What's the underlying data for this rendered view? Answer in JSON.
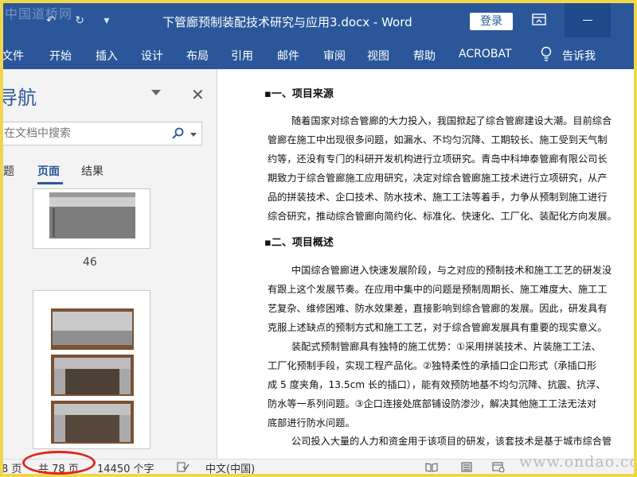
{
  "watermarks": {
    "top": "中国道桥网",
    "bottom": "www.ondao.com"
  },
  "titlebar": {
    "qat_undo": "↶",
    "qat_redo": "↻",
    "qat_more": "▾",
    "title": "下管廊预制装配技术研究与应用3.docx  -  Word",
    "login": "登录"
  },
  "ribbon": {
    "tabs": [
      "文件",
      "开始",
      "插入",
      "设计",
      "布局",
      "引用",
      "邮件",
      "审阅",
      "视图",
      "帮助",
      "ACROBAT",
      "告诉我"
    ]
  },
  "nav": {
    "title": "导航",
    "close": "✕",
    "search_placeholder": "在文档中搜索",
    "tabs": [
      "题",
      "页面",
      "结果"
    ],
    "page_number": "46"
  },
  "document": {
    "h1": "一、项目来源",
    "p1": [
      "随着国家对综合管廊的大力投入，我国掀起了综合管廊建设大潮。目前综合",
      "管廊在施工中出现很多问题，如漏水、不均匀沉降、工期较长、施工受到天气制",
      "约等，还没有专门的科研开发机构进行立项研究。青岛中科坤泰管廊有限公司长",
      "期致力于综合管廊施工应用研究，决定对综合管廊施工技术进行立项研究，从产",
      "品的拼装技术、企口技术、防水技术、施工工法等着手，力争从预制到施工进行",
      "综合研究，推动综合管廊向简约化、标准化、快速化、工厂化、装配化方向发展。"
    ],
    "h2": "二、项目概述",
    "p2": [
      "中国综合管廊进入快速发展阶段，与之对应的预制技术和施工工艺的研发没",
      "有跟上这个发展节奏。在应用中集中的问题是预制周期长、施工难度大、施工工",
      "艺复杂、维修困难、防水效果差，直接影响到综合管廊的发展。因此，研发具有",
      "克服上述缺点的预制方式和施工工艺，对于综合管廊发展具有重要的现实意义。"
    ],
    "p3": [
      "装配式预制管廊具有独特的施工优势：①采用拼装技术、片装施工工法、",
      "工厂化预制手段，实现工程产品化。②独特柔性的承插口企口形式（承插口形",
      "成 5 度夹角，13.5cm 长的插口），能有效预防地基不均匀沉降、抗震、抗浮、",
      "防水等一系列问题。③企口连接处底部铺设防渗沙，解决其他施工工法无法对",
      "底部进行防水问题。"
    ],
    "p4": [
      "公司投入大量的人力和资金用于该项目的研发，该套技术是基于城市综合管"
    ]
  },
  "statusbar": {
    "page": "8 页",
    "total_pages": "共 78 页",
    "words": "14450 个字",
    "language": "中文(中国)"
  },
  "colors": {
    "word_blue": "#2b579a",
    "annotation_red": "#e0261b",
    "frame_yellow": "#f0d64a"
  }
}
